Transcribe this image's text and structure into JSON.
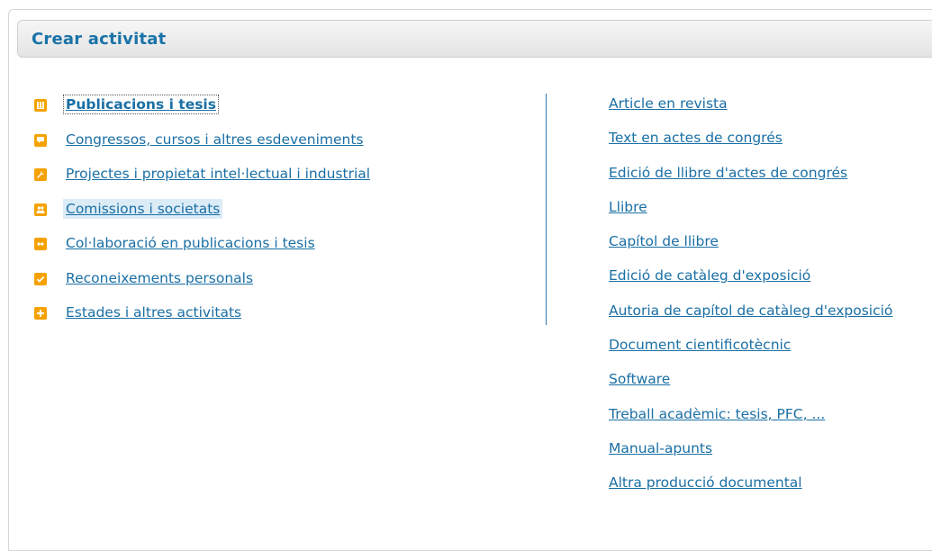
{
  "header": {
    "title": "Crear activitat"
  },
  "categories": [
    {
      "label": "Publicacions i tesis",
      "icon": "book-icon"
    },
    {
      "label": "Congressos, cursos i altres esdeveniments",
      "icon": "speech-bubble-icon"
    },
    {
      "label": "Projectes i propietat intel·lectual i industrial",
      "icon": "wrench-icon"
    },
    {
      "label": "Comissions i societats",
      "icon": "people-icon"
    },
    {
      "label": "Col·laboració en publicacions i tesis",
      "icon": "arrows-icon"
    },
    {
      "label": "Reconeixements personals",
      "icon": "checkmark-icon"
    },
    {
      "label": "Estades i altres activitats",
      "icon": "plus-icon"
    }
  ],
  "subtypes": [
    "Article en revista",
    "Text en actes de congrés",
    "Edició de llibre d'actes de congrés",
    "Llibre",
    "Capítol de llibre",
    "Edició de catàleg d'exposició",
    "Autoria de capítol de catàleg d'exposició",
    "Document cientificotècnic",
    "Software",
    "Treball acadèmic: tesis, PFC, ...",
    "Manual-apunts",
    "Altra producció documental"
  ],
  "colors": {
    "accent": "#1a6fa5",
    "icon_bg": "#f5a200",
    "divider": "#2f7ab0"
  }
}
